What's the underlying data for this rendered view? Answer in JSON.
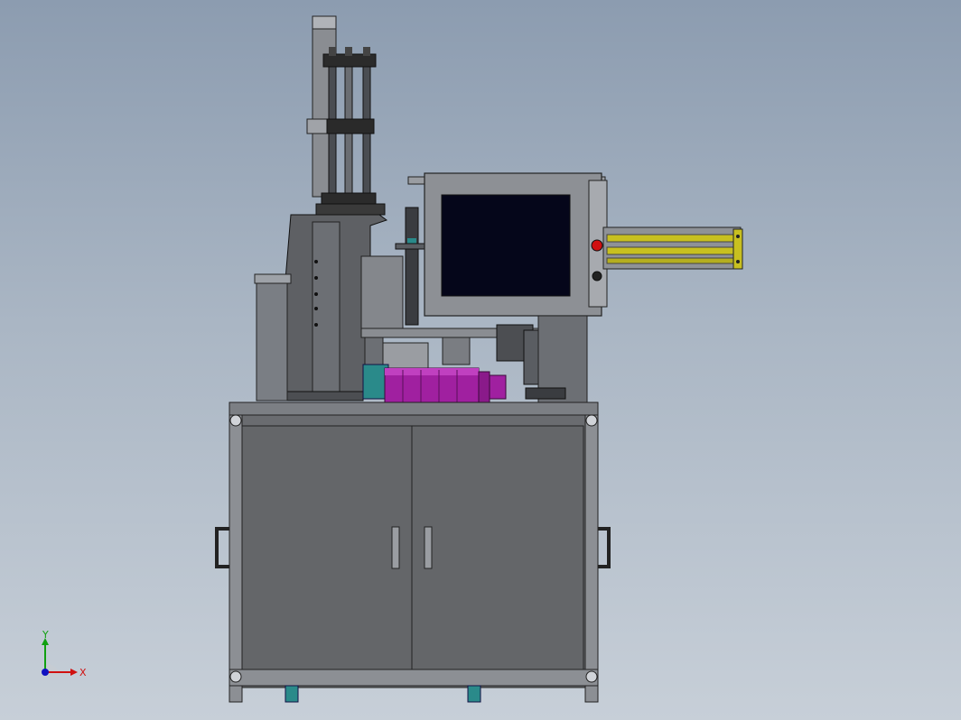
{
  "viewport": {
    "background_top": "#8c9cb0",
    "background_bottom": "#c7cfd8"
  },
  "model": {
    "body_color": "#6a6a6a",
    "motor_color": "#a020a0",
    "screen_color": "#05061a",
    "cylinder_color": "#c8c020",
    "accent_red": "#d01010",
    "teal_color": "#2a8a8a"
  },
  "triad": {
    "x_label": "X",
    "y_label": "Y",
    "x_color": "#d01010",
    "y_color": "#10a010",
    "z_color": "#1010c0"
  }
}
